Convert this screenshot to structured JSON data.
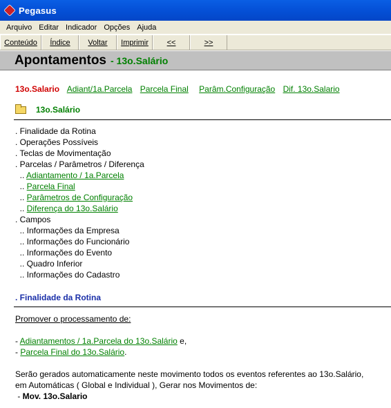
{
  "window": {
    "title": "Pegasus"
  },
  "menu": [
    "Arquivo",
    "Editar",
    "Indicador",
    "Opções",
    "Ajuda"
  ],
  "toolbar": [
    "Conteúdo",
    "Índice",
    "Voltar",
    "Imprimir",
    "<<",
    ">>"
  ],
  "header": {
    "title": "Apontamentos",
    "subtitle": "- 13o.Salário"
  },
  "nav": {
    "current": "13o.Salario",
    "links": [
      "Adiant/1a.Parcela",
      "Parcela Final",
      "Parâm.Configuração",
      "Dif. 13o.Salario"
    ]
  },
  "section": {
    "title": "13o.Salário"
  },
  "toc": [
    {
      "prefix": ". ",
      "text": "Finalidade da Rotina",
      "link": false
    },
    {
      "prefix": ". ",
      "text": "Operações Possíveis",
      "link": false
    },
    {
      "prefix": ". ",
      "text": "Teclas de Movimentação",
      "link": false
    },
    {
      "prefix": ". ",
      "text": "Parcelas / Parâmetros / Diferença",
      "link": false
    },
    {
      "prefix": "  .. ",
      "text": "Adiantamento / 1a.Parcela",
      "link": true
    },
    {
      "prefix": "  .. ",
      "text": "Parcela Final",
      "link": true
    },
    {
      "prefix": "  .. ",
      "text": "Parâmetros de Configuração",
      "link": true
    },
    {
      "prefix": "  .. ",
      "text": "Diferença do 13o.Salário",
      "link": true
    },
    {
      "prefix": ". ",
      "text": "Campos",
      "link": false
    },
    {
      "prefix": "  .. ",
      "text": "Informações da Empresa",
      "link": false
    },
    {
      "prefix": "  .. ",
      "text": "Informações do Funcionário",
      "link": false
    },
    {
      "prefix": "  .. ",
      "text": "Informações do Evento",
      "link": false
    },
    {
      "prefix": "  .. ",
      "text": "Quadro Inferior",
      "link": false
    },
    {
      "prefix": "  .. ",
      "text": "Informações do Cadastro",
      "link": false
    }
  ],
  "finalidade": {
    "heading": ". Finalidade da Rotina"
  },
  "body": {
    "promover": "Promover o processamento de:",
    "item1_prefix": "- ",
    "item1_link": "Adiantamentos / 1a.Parcela do 13o.Salário",
    "item1_suffix": " e,",
    "item2_prefix": "- ",
    "item2_link": "Parcela Final do 13o.Salário",
    "item2_suffix": ".",
    "para_line1": "Serão gerados automaticamente neste movimento todos os eventos referentes ao 13o.Salário,",
    "para_line2": "em Automáticas ( Global e Individual ), Gerar nos Movimentos de:",
    "mov_prefix": " - ",
    "mov_text": "Mov. 13o.Salario"
  }
}
